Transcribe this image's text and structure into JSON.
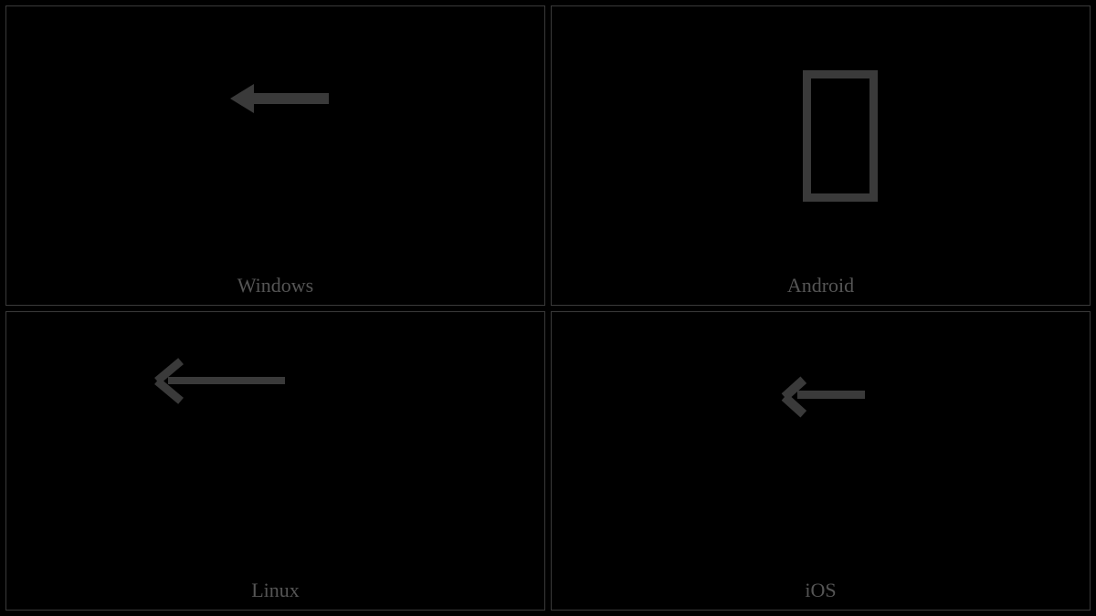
{
  "cells": [
    {
      "label": "Windows",
      "glyph": "left-arrow"
    },
    {
      "label": "Android",
      "glyph": "missing"
    },
    {
      "label": "Linux",
      "glyph": "left-arrow"
    },
    {
      "label": "iOS",
      "glyph": "left-arrow"
    }
  ]
}
